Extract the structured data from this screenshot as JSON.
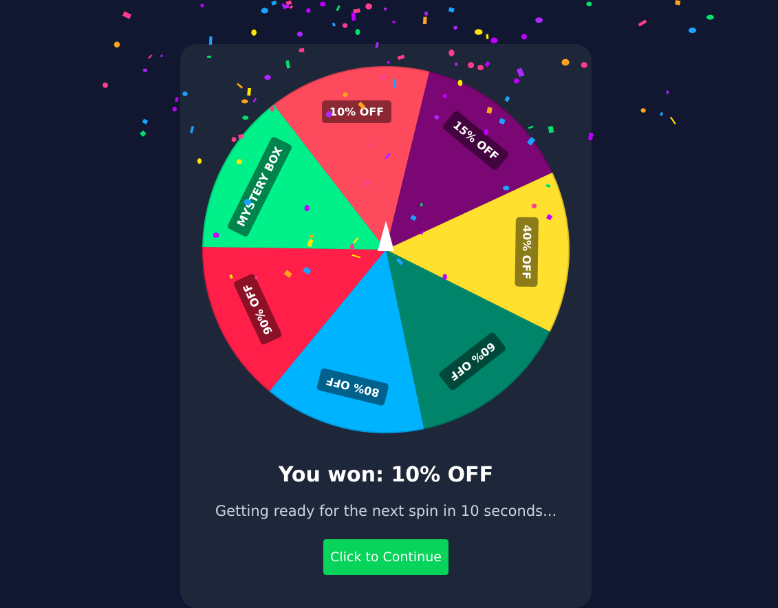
{
  "wheel": {
    "segments": [
      {
        "label": "10% OFF",
        "color": "#fd4a5c"
      },
      {
        "label": "15% OFF",
        "color": "#7a0773"
      },
      {
        "label": "40% OFF",
        "color": "#ffe02e"
      },
      {
        "label": "60% OFF",
        "color": "#00856a"
      },
      {
        "label": "80% OFF",
        "color": "#00b3ff"
      },
      {
        "label": "90% OFF",
        "color": "#ff1f48"
      },
      {
        "label": "MYSTERY BOX",
        "color": "#00f08a"
      }
    ],
    "pointer_color": "#ffffff"
  },
  "result": {
    "title": "You won: 10% OFF",
    "subtitle": "Getting ready for the next spin in 10 seconds..."
  },
  "continue_button": {
    "label": "Click to Continue",
    "color": "#08d35a"
  },
  "theme": {
    "background": "#111631",
    "card": "#1e2639"
  },
  "confetti_colors": [
    "#ff3d8b",
    "#b026ff",
    "#ffa31a",
    "#00e06b",
    "#1aa3ff",
    "#ffe600",
    "#c000ff"
  ]
}
